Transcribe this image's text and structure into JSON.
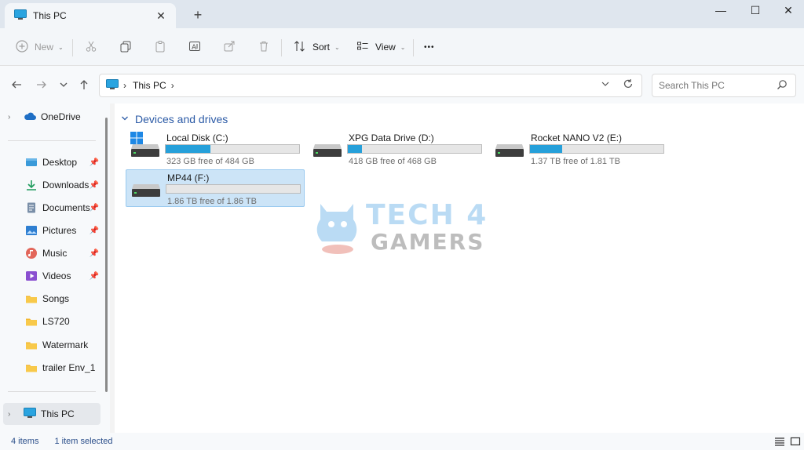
{
  "window": {
    "tab_title": "This PC",
    "tab_close": "✕",
    "new_tab": "+",
    "minimize": "—",
    "maximize": "☐",
    "close": "✕"
  },
  "toolbar": {
    "new_label": "New",
    "sort_label": "Sort",
    "view_label": "View",
    "more_label": "•••"
  },
  "address": {
    "location": "This PC",
    "search_placeholder": "Search This PC"
  },
  "sidebar": {
    "top_items": [
      {
        "label": "OneDrive",
        "icon": "cloud-icon"
      }
    ],
    "quick_access": [
      {
        "label": "Desktop",
        "icon": "desktop-icon",
        "pinned": true
      },
      {
        "label": "Downloads",
        "icon": "download-icon",
        "pinned": true
      },
      {
        "label": "Documents",
        "icon": "document-icon",
        "pinned": true
      },
      {
        "label": "Pictures",
        "icon": "picture-icon",
        "pinned": true
      },
      {
        "label": "Music",
        "icon": "music-icon",
        "pinned": true
      },
      {
        "label": "Videos",
        "icon": "video-icon",
        "pinned": true
      },
      {
        "label": "Songs",
        "icon": "folder-icon",
        "pinned": false
      },
      {
        "label": "LS720",
        "icon": "folder-icon",
        "pinned": false
      },
      {
        "label": "Watermark",
        "icon": "folder-icon",
        "pinned": false
      },
      {
        "label": "trailer Env_1",
        "icon": "folder-icon",
        "pinned": false
      }
    ],
    "this_pc": "This PC"
  },
  "main": {
    "group_title": "Devices and drives",
    "drives": [
      {
        "name": "Local Disk (C:)",
        "free": "323 GB free of 484 GB",
        "used_fraction": 0.333,
        "windows": true,
        "selected": false
      },
      {
        "name": "XPG Data Drive (D:)",
        "free": "418 GB free of 468 GB",
        "used_fraction": 0.107,
        "windows": false,
        "selected": false
      },
      {
        "name": "Rocket NANO V2 (E:)",
        "free": "1.37 TB free of 1.81 TB",
        "used_fraction": 0.243,
        "windows": false,
        "selected": false
      },
      {
        "name": "MP44 (F:)",
        "free": "1.86 TB free of 1.86 TB",
        "used_fraction": 0.0,
        "windows": false,
        "selected": true
      }
    ]
  },
  "watermark": {
    "line1": "TECH 4",
    "line2": "GAMERS"
  },
  "status": {
    "item_count": "4 items",
    "selection": "1 item selected"
  },
  "colors": {
    "accent": "#26a0da",
    "selection_bg": "#cce4f7",
    "group_header": "#2b5aa6"
  }
}
